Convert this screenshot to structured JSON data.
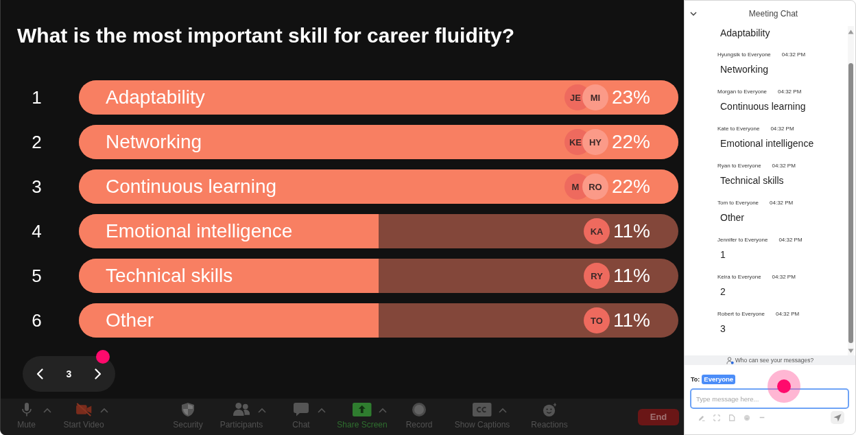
{
  "poll": {
    "question": "What is the most important skill for career fluidity?",
    "options": [
      {
        "rank": "1",
        "label": "Adaptability",
        "level": 1,
        "percent": "23%",
        "voters": [
          {
            "initials": "JE",
            "color": "#ee6a5e"
          },
          {
            "initials": "MI",
            "color": "#fb9a88"
          }
        ]
      },
      {
        "rank": "2",
        "label": "Networking",
        "level": 1,
        "percent": "22%",
        "voters": [
          {
            "initials": "KE",
            "color": "#ee6a5e"
          },
          {
            "initials": "HY",
            "color": "#fb9a88"
          }
        ]
      },
      {
        "rank": "3",
        "label": "Continuous learning",
        "level": 1,
        "percent": "22%",
        "voters": [
          {
            "initials": "M",
            "color": "#ee6a5e"
          },
          {
            "initials": "RO",
            "color": "#fb9a88"
          }
        ]
      },
      {
        "rank": "4",
        "label": "Emotional intelligence",
        "level": 0.5,
        "percent": "11%",
        "voters": [
          {
            "initials": "KA",
            "color": "#ee6a5e"
          }
        ]
      },
      {
        "rank": "5",
        "label": "Technical skills",
        "level": 0.5,
        "percent": "11%",
        "voters": [
          {
            "initials": "RY",
            "color": "#ee6a5e"
          }
        ]
      },
      {
        "rank": "6",
        "label": "Other",
        "level": 0.5,
        "percent": "11%",
        "voters": [
          {
            "initials": "TO",
            "color": "#ee6a5e"
          }
        ]
      }
    ]
  },
  "pager": {
    "page": "3"
  },
  "toolbar": {
    "left": [
      {
        "kind": "mute",
        "label": "Mute",
        "menu": true
      },
      {
        "kind": "video",
        "label": "Start Video",
        "menu": true
      }
    ],
    "center": [
      {
        "kind": "security",
        "label": "Security",
        "menu": false
      },
      {
        "kind": "participants",
        "label": "Participants",
        "menu": true
      },
      {
        "kind": "chat",
        "label": "Chat",
        "menu": true
      },
      {
        "kind": "share",
        "label": "Share Screen",
        "menu": true
      },
      {
        "kind": "record",
        "label": "Record",
        "menu": false
      },
      {
        "kind": "captions",
        "label": "Show Captions",
        "menu": true
      },
      {
        "kind": "reactions",
        "label": "Reactions",
        "menu": false
      }
    ],
    "end": {
      "label": "End"
    }
  },
  "chat": {
    "title": "Meeting Chat",
    "messages": [
      {
        "text": "Adaptability"
      },
      {
        "sender": "Hyungsik to Everyone",
        "time": "04:32 PM",
        "text": "Networking"
      },
      {
        "sender": "Morgan to Everyone",
        "time": "04:32 PM",
        "text": "Continuous learning"
      },
      {
        "sender": "Kate to Everyone",
        "time": "04:32 PM",
        "text": "Emotional intelligence"
      },
      {
        "sender": "Ryan to Everyone",
        "time": "04:32 PM",
        "text": "Technical skills"
      },
      {
        "sender": "Tom to Everyone",
        "time": "04:32 PM",
        "text": "Other"
      },
      {
        "sender": "Jennifer to Everyone",
        "time": "04:32 PM",
        "text": "1"
      },
      {
        "sender": "Keira to Everyone",
        "time": "04:32 PM",
        "text": "2"
      },
      {
        "sender": "Robert to Everyone",
        "time": "04:32 PM",
        "text": "3"
      }
    ],
    "privacy_note": "Who can see your messages?",
    "recipient_label": "To:",
    "recipient": "Everyone",
    "input": {
      "placeholder": "Type message here..."
    }
  }
}
